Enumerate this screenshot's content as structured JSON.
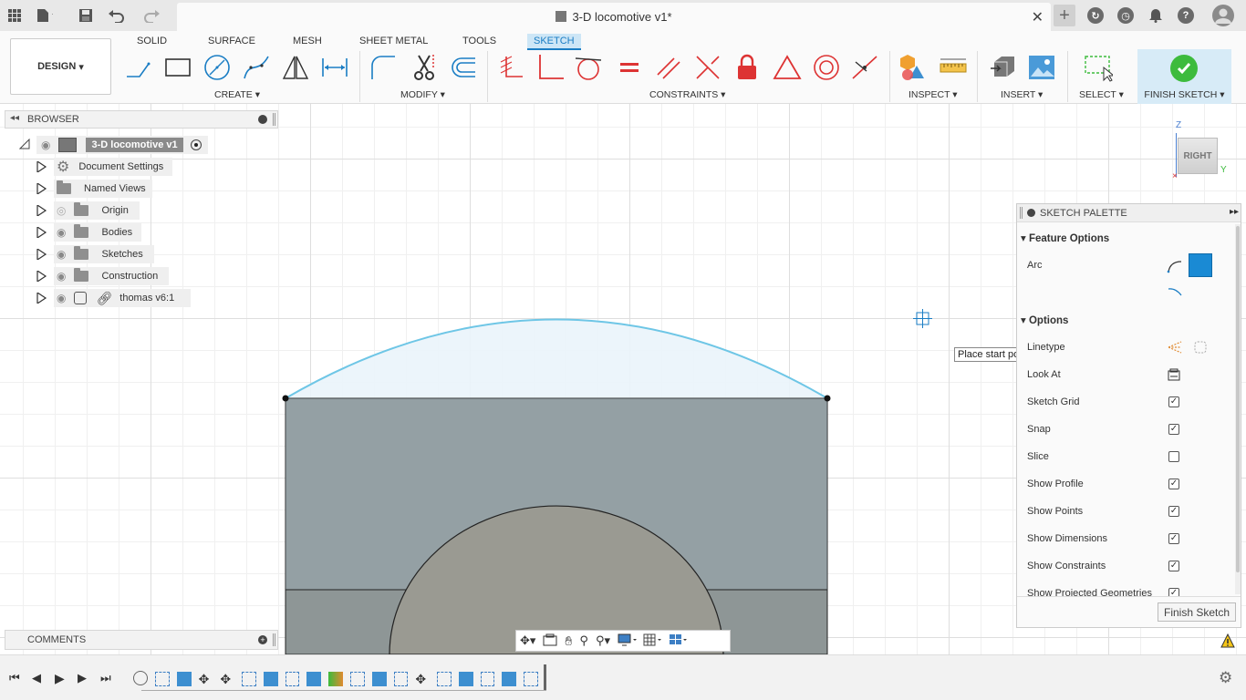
{
  "window": {
    "title": "3-D locomotive v1*"
  },
  "toolbar": {
    "workspace": "DESIGN",
    "tabs": [
      "SOLID",
      "SURFACE",
      "MESH",
      "SHEET METAL",
      "TOOLS",
      "SKETCH"
    ],
    "active_tab": "SKETCH",
    "groups": {
      "create": "CREATE",
      "modify": "MODIFY",
      "constraints": "CONSTRAINTS",
      "inspect": "INSPECT",
      "insert": "INSERT",
      "select": "SELECT",
      "finish": "FINISH SKETCH"
    }
  },
  "browser": {
    "title": "BROWSER",
    "root": "3-D locomotive v1",
    "items": [
      {
        "label": "Document Settings",
        "icon": "gear-icon"
      },
      {
        "label": "Named Views",
        "icon": "folder-icon"
      },
      {
        "label": "Origin",
        "icon": "folder-icon"
      },
      {
        "label": "Bodies",
        "icon": "folder-icon"
      },
      {
        "label": "Sketches",
        "icon": "folder-icon"
      },
      {
        "label": "Construction",
        "icon": "folder-icon"
      },
      {
        "label": "thomas v6:1",
        "icon": "component-link-icon"
      }
    ]
  },
  "viewcube": {
    "face": "RIGHT",
    "axis_z": "Z",
    "axis_y": "Y"
  },
  "tooltip": "Place start point",
  "palette": {
    "title": "SKETCH PALETTE",
    "feature_options": "Feature Options",
    "arc_label": "Arc",
    "options": "Options",
    "rows": [
      {
        "label": "Linetype",
        "type": "icons"
      },
      {
        "label": "Look At",
        "type": "icon"
      },
      {
        "label": "Sketch Grid",
        "checked": true
      },
      {
        "label": "Snap",
        "checked": true
      },
      {
        "label": "Slice",
        "checked": false
      },
      {
        "label": "Show Profile",
        "checked": true
      },
      {
        "label": "Show Points",
        "checked": true
      },
      {
        "label": "Show Dimensions",
        "checked": true
      },
      {
        "label": "Show Constraints",
        "checked": true
      },
      {
        "label": "Show Projected Geometries",
        "checked": true
      }
    ],
    "finish_button": "Finish Sketch"
  },
  "comments": {
    "title": "COMMENTS"
  },
  "colors": {
    "accent": "#1a7dc4",
    "finish_green": "#3dbb3d",
    "sketch_line": "#6ec6e6",
    "body_gray": "#8e9696"
  }
}
